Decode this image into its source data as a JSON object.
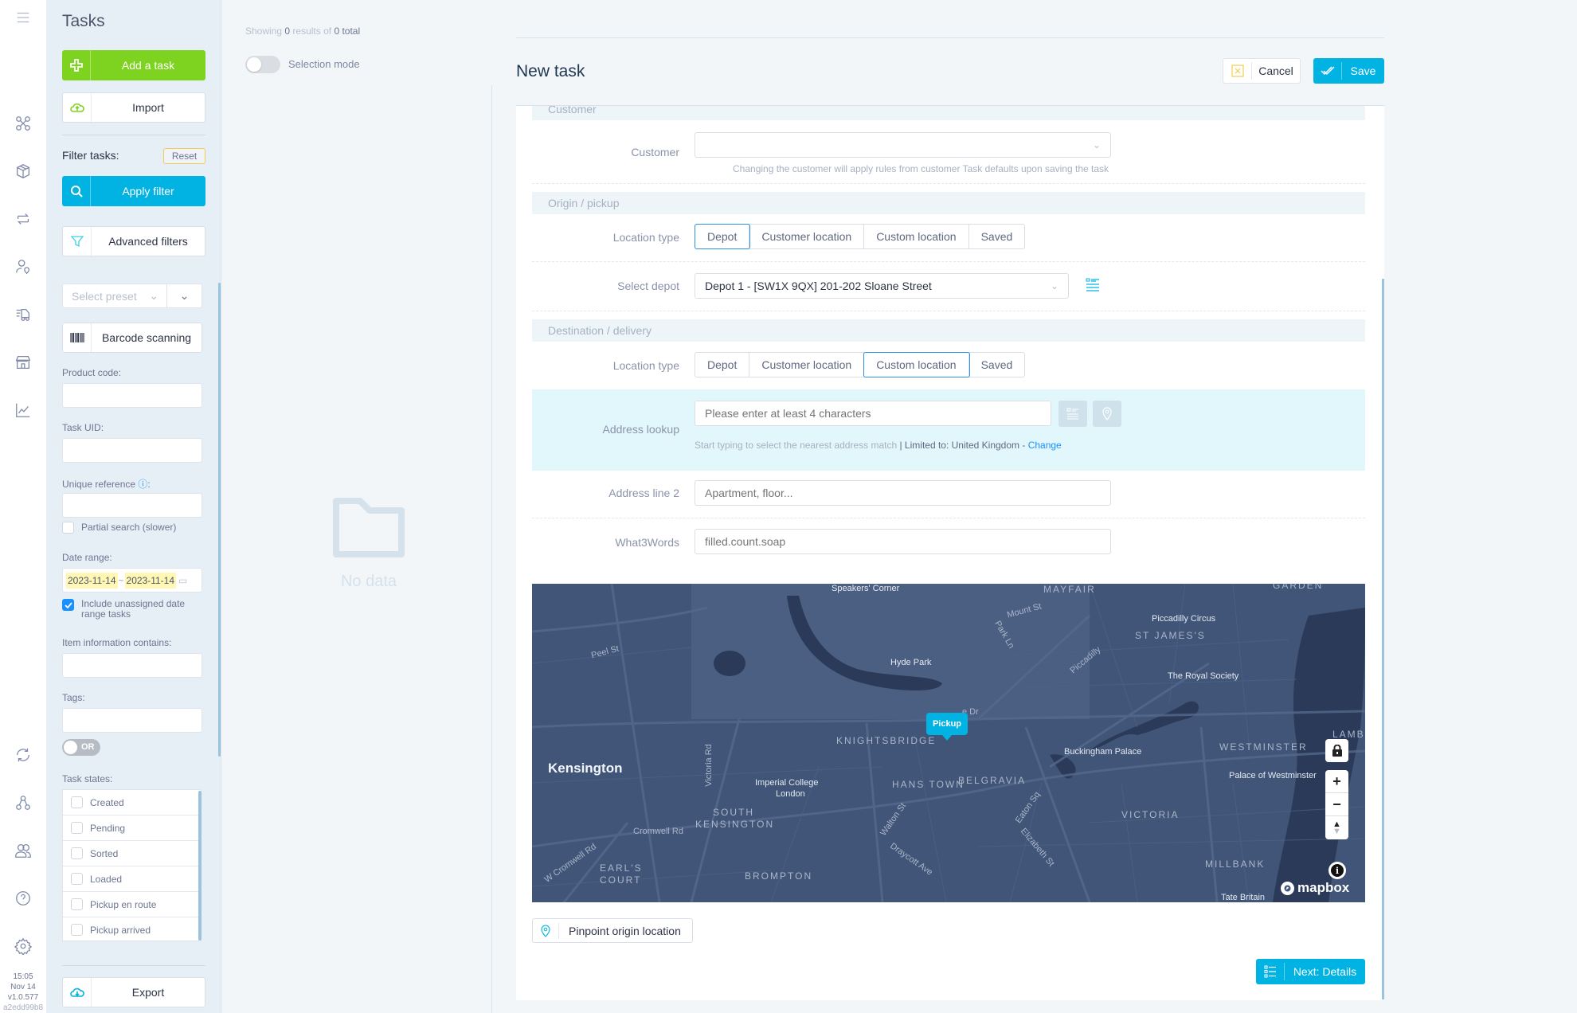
{
  "rail": {
    "icons": [
      "menu-icon",
      "routes-icon",
      "package-icon",
      "transfer-icon",
      "driver-location-icon",
      "delivery-truck-icon",
      "store-icon",
      "analytics-icon",
      "sync-icon",
      "network-icon",
      "users-icon",
      "help-icon",
      "settings-icon"
    ],
    "time": "15:05",
    "date": "Nov 14",
    "version": "v1.0.577",
    "hash": "a2edd99b8"
  },
  "filters": {
    "title": "Tasks",
    "add_task": "Add a task",
    "import": "Import",
    "filter_tasks_label": "Filter tasks:",
    "reset": "Reset",
    "apply_filter": "Apply filter",
    "advanced_filters": "Advanced filters",
    "select_preset_placeholder": "Select preset",
    "barcode_scanning": "Barcode scanning",
    "product_code_label": "Product code",
    "task_uid_label": "Task UID",
    "unique_reference_label": "Unique reference",
    "partial_search_label": "Partial search (slower)",
    "partial_search_checked": false,
    "date_range_label": "Date range",
    "date_from": "2023-11-14",
    "date_to": "2023-11-14",
    "include_unassigned_label": "Include unassigned date range tasks",
    "include_unassigned_checked": true,
    "item_info_label": "Item information contains",
    "tags_label": "Tags",
    "tags_mode": "OR",
    "task_states_label": "Task states",
    "task_states": [
      {
        "label": "Created",
        "checked": false
      },
      {
        "label": "Pending",
        "checked": false
      },
      {
        "label": "Sorted",
        "checked": false
      },
      {
        "label": "Loaded",
        "checked": false
      },
      {
        "label": "Pickup en route",
        "checked": false
      },
      {
        "label": "Pickup arrived",
        "checked": false
      }
    ],
    "export": "Export",
    "colon": ":"
  },
  "list": {
    "showing_prefix": "Showing",
    "showing_count": "0",
    "showing_mid": "results of",
    "showing_total": "0",
    "showing_suffix": "total",
    "selection_mode": "Selection mode",
    "no_data": "No data"
  },
  "form": {
    "title": "New task",
    "cancel": "Cancel",
    "save": "Save",
    "customer_section": "Customer",
    "customer_label": "Customer",
    "customer_value": "",
    "customer_hint": "Changing the customer will apply rules from customer Task defaults upon saving the task",
    "origin_section": "Origin / pickup",
    "location_type_label": "Location type",
    "location_types": [
      "Depot",
      "Customer location",
      "Custom location",
      "Saved"
    ],
    "origin_selected": "Depot",
    "select_depot_label": "Select depot",
    "depot_value": "Depot 1 - [SW1X 9QX] 201-202 Sloane Street",
    "destination_section": "Destination / delivery",
    "destination_selected": "Custom location",
    "address_lookup_label": "Address lookup",
    "address_lookup_placeholder": "Please enter at least 4 characters",
    "address_hint": "Start typing to select the nearest address match",
    "address_limit": "| Limited to: United Kingdom -",
    "address_change": "Change",
    "address_line2_label": "Address line 2",
    "address_line2_placeholder": "Apartment, floor...",
    "what3words_label": "What3Words",
    "what3words_placeholder": "filled.count.soap",
    "pinpoint_button": "Pinpoint origin location",
    "next_button": "Next: Details"
  },
  "map": {
    "marker_label": "Pickup",
    "attribution": "mapbox",
    "labels": {
      "speakers_corner": "Speakers' Corner",
      "mayfair": "MAYFAIR",
      "garden": "GARDEN",
      "mount_st": "Mount St",
      "park_ln": "Park Ln",
      "piccadilly_circus": "Piccadilly Circus",
      "st_james": "ST JAMES'S",
      "piccadilly": "Piccadilly",
      "peel_st": "Peel St",
      "hyde_park": "Hyde Park",
      "royal_society": "The Royal Society",
      "knightsbridge": "KNIGHTSBRIDGE",
      "lambeth": "LAMBETH",
      "kensington": "Kensington",
      "victoria_rd": "Victoria Rd",
      "buckingham_palace": "Buckingham Palace",
      "westminster": "WESTMINSTER",
      "imperial_college": "Imperial College",
      "london": "London",
      "hans_town": "HANS TOWN",
      "belgravia": "BELGRAVIA",
      "palace_westminster": "Palace of Westminster",
      "south": "SOUTH",
      "kensington_area": "KENSINGTON",
      "eaton_sq": "Eaton Sq",
      "victoria": "VICTORIA",
      "cromwell_rd": "Cromwell Rd",
      "walton_st": "Walton St",
      "elizabeth_st": "Elizabeth St",
      "w_cromwell_rd": "W Cromwell Rd",
      "earls": "EARL'S",
      "court": "COURT",
      "draycott_ave": "Draycott Ave",
      "millbank": "MILLBANK",
      "brompton": "BROMPTON",
      "tate_britain": "Tate Britain",
      "dr": "e Dr"
    }
  },
  "colors": {
    "primary": "#00b3e3",
    "success": "#7ed321",
    "warning_outline": "#f2cd4f",
    "map_bg": "#405577"
  }
}
